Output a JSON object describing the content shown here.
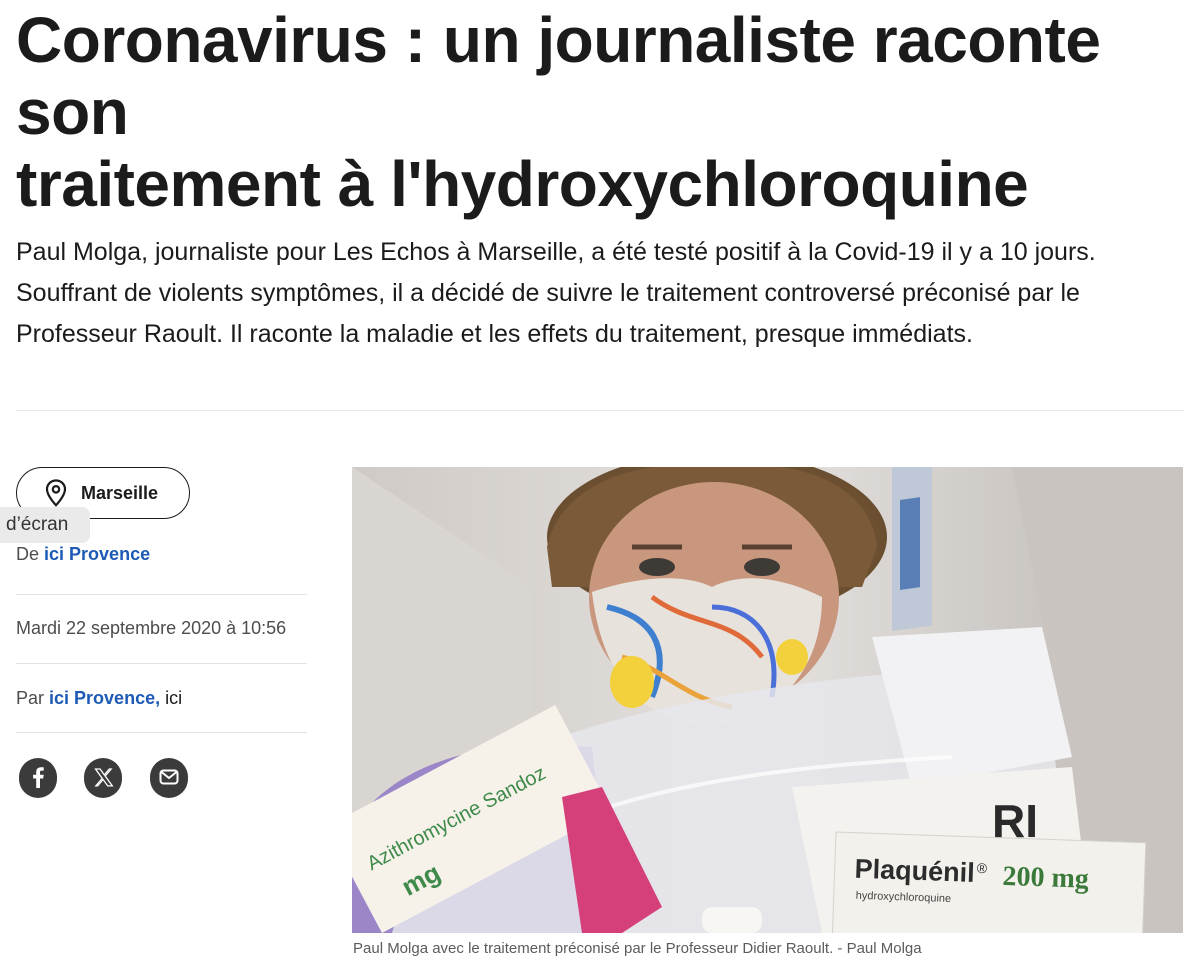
{
  "article": {
    "headline_line1": "Coronavirus : un journaliste raconte son",
    "headline_line2": "traitement à l'hydroxychloroquine",
    "chapo_line1": "Paul Molga, journaliste pour Les Echos à Marseille, a été testé positif à la Covid-19 il y a 10 jours.",
    "chapo_line2": "Souffrant de violents symptômes, il a décidé de suivre le traitement controversé préconisé par le",
    "chapo_line3": "Professeur Raoult. Il raconte la maladie et les effets du traitement, presque immédiats."
  },
  "sidebar": {
    "location_label": "Marseille",
    "location_icon": "map-pin-icon",
    "tooltip_text": "d’écran",
    "source_prefix": "De",
    "source_link": "ici Provence",
    "date": "Mardi 22 septembre 2020 à 10:56",
    "author_prefix": "Par",
    "author_link": "ici Provence,",
    "author_extra": "ici",
    "share_icons": [
      "facebook-icon",
      "x-icon",
      "mail-icon"
    ]
  },
  "photo": {
    "box_plaquenil_brand": "Plaquénil",
    "box_plaquenil_reg": "®",
    "box_plaquenil_dose": "200 mg",
    "box_plaquenil_sub": "hydroxychloroquine",
    "box_azithro_name": "Azithromycine Sandoz",
    "box_azithro_dose": "mg",
    "caption": "Paul Molga avec le traitement préconisé par le Professeur Didier Raoult. - Paul Molga"
  },
  "colors": {
    "link": "#1d5ab5",
    "text": "#1b1b1b",
    "icon_bg": "#3b3b3b"
  }
}
